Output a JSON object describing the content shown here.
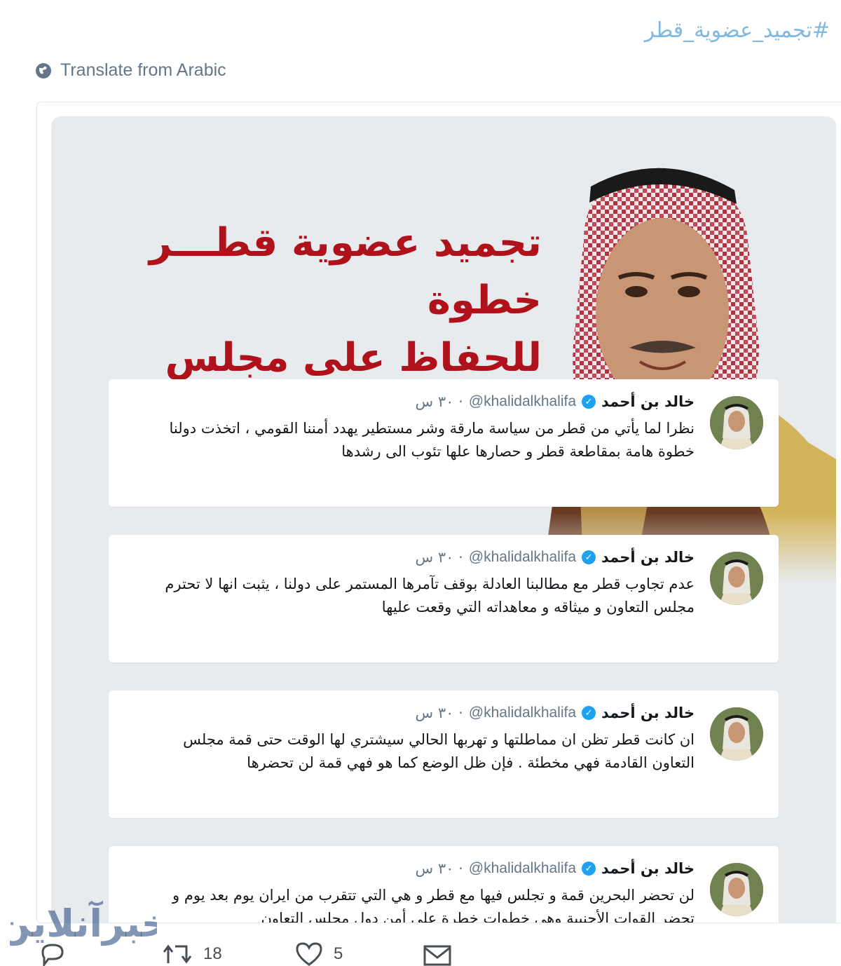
{
  "hashtag": "#تجميد_عضوية_قطر",
  "translate_label": "Translate from Arabic",
  "media": {
    "headline_line1": "تجميد عضوية قطـــر خطوة",
    "headline_line2": "للحفاظ على مجلس التعاون",
    "tweets": [
      {
        "name": "خالد بن أحمد",
        "handle": "@khalidalkhalifa",
        "time": "· ٣٠ س",
        "text": "نظرا لما يأتي من قطر  من سياسة مارقة وشر مستطير يهدد أمننا  القومي ، اتخذت دولنا خطوة هامة بمقاطعة قطر و حصارها علها تئوب الى رشدها"
      },
      {
        "name": "خالد بن أحمد",
        "handle": "@khalidalkhalifa",
        "time": "· ٣٠ س",
        "text": "عدم تجاوب قطر مع مطالبنا العادلة بوقف تآمرها المستمر على دولنا ،  يثبت انها لا تحترم مجلس التعاون و ميثاقه و معاهداته التي وقعت عليها"
      },
      {
        "name": "خالد بن أحمد",
        "handle": "@khalidalkhalifa",
        "time": "· ٣٠ س",
        "text": "ان كانت قطر تظن ان مماطلتها و تهربها الحالي سيشتري لها الوقت حتى قمة مجلس التعاون القادمة فهي مخطئة . فإن ظل الوضع كما هو فهي قمة لن تحضرها"
      },
      {
        "name": "خالد بن أحمد",
        "handle": "@khalidalkhalifa",
        "time": "· ٣٠ س",
        "text": "لن تحضر البحرين قمة و تجلس فيها مع قطر و هي التي تتقرب من ايران يوم بعد يوم و تحضر القوات الأجنبية وهي خطوات خطرة على أمن دول مجلس التعاون"
      }
    ]
  },
  "watermark": "خبرآنلاین",
  "actions": {
    "reply_count": "",
    "retweet_count": "18",
    "like_count": "5"
  },
  "colors": {
    "headline": "#b0121b",
    "hashtag": "#7fb9e0",
    "verified": "#1da1f2",
    "media_bg": "#e8ebee"
  }
}
